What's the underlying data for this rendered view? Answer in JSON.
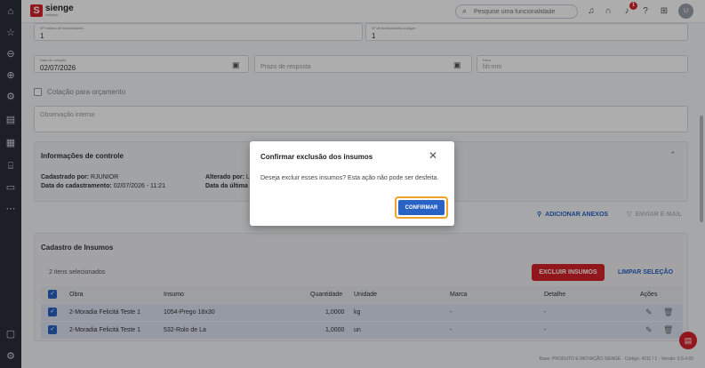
{
  "brand": {
    "name": "sienge",
    "sub": "softplan",
    "accent": "#d8232a",
    "primary": "#2962c5"
  },
  "search": {
    "placeholder": "Pesquise uma funcionalidade"
  },
  "topbar": {
    "notifications_count": "1",
    "avatar_initials": "U"
  },
  "sidebar": {
    "items": [
      "home-icon",
      "star-icon",
      "globe-icon",
      "cube-icon",
      "gear-icon",
      "document-icon",
      "calculator-icon",
      "building-icon",
      "monitor-icon",
      "more-icon"
    ],
    "bottom": [
      "chat-icon",
      "settings-icon"
    ]
  },
  "form": {
    "qty_label": "Nº mínimo de fornecedores",
    "qty_value": "1",
    "pay_label": "Nº de fornecedores a pagar",
    "pay_value": "1",
    "date_label": "Data de cotação",
    "date_value": "02/07/2026",
    "deadline_placeholder": "Prazo de resposta",
    "time_label": "Hora",
    "time_placeholder": "hh:mm",
    "budget_checkbox": "Cotação para orçamento",
    "internal_note_placeholder": "Observação interna"
  },
  "control_panel": {
    "title": "Informações de controle",
    "created_by_label": "Cadastrado por:",
    "created_by_value": "RJUNIOR",
    "created_at_label": "Data do cadastramento:",
    "created_at_value": "02/07/2026 - 11:21",
    "altered_by_label": "Alterado por:",
    "altered_by_value": "L",
    "last_label": "Data da última"
  },
  "actions": {
    "add_attachments": "ADICIONAR ANEXOS",
    "send_email": "ENVIAR E-MAIL"
  },
  "inputs_section": {
    "title": "Cadastro de Insumos",
    "selected_count": "2 itens selecionados",
    "delete_button": "EXCLUIR INSUMOS",
    "clear_button": "LIMPAR SELEÇÃO",
    "columns": [
      "Obra",
      "Insumo",
      "Quantidade",
      "Unidade",
      "Marca",
      "Detalhe",
      "Ações"
    ],
    "rows": [
      {
        "obra": "2-Moradia Felicitá Teste 1",
        "insumo": "1054-Prego 18x30",
        "quantidade": "1,0000",
        "unidade": "kg",
        "marca": "-",
        "detalhe": "-"
      },
      {
        "obra": "2-Moradia Felicitá Teste 1",
        "insumo": "532-Rolo de La",
        "quantidade": "1,0000",
        "unidade": "un",
        "marca": "-",
        "detalhe": "-"
      }
    ]
  },
  "footer": {
    "info": "Base: PRODUTO E INOVAÇÃO SIENGE · Código: 4211 / 1 · Versão: 9.5.4.65"
  },
  "dialog": {
    "title": "Confirmar exclusão dos insumos",
    "body": "Deseja excluir esses insumos? Esta ação não pode ser desfeita.",
    "confirm": "CONFIRMAR"
  }
}
